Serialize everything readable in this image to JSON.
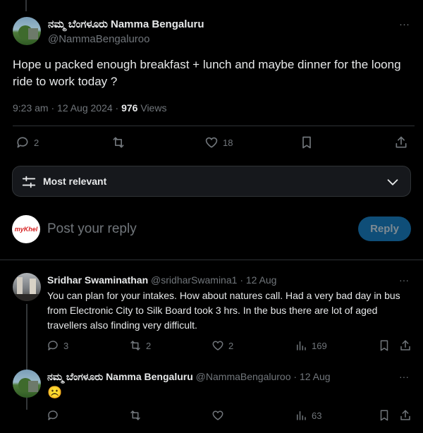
{
  "tweet": {
    "author_name": "ನಮ್ಮ ಬೆಂಗಳೂರು Namma Bengaluru",
    "handle": "@NammaBengaluroo",
    "text": "Hope u packed enough breakfast + lunch and maybe dinner for the loong ride to work today ?",
    "time": "9:23 am · 12 Aug 2024 · ",
    "views_count": "976",
    "views_label": " Views",
    "replies": "2",
    "likes": "18",
    "more": "···"
  },
  "filter": {
    "label": "Most relevant"
  },
  "compose": {
    "avatar_text": "myKhel",
    "placeholder": "Post your reply",
    "reply_button": "Reply"
  },
  "replies": [
    {
      "name": "Sridhar Swaminathan",
      "handle": "@sridharSwamina1",
      "time": "· 12 Aug",
      "text": "You can plan for your intakes.  How about natures call.  Had a very bad day in bus from Electronic City to Silk Board took 3 hrs. In the bus there are lot of aged travellers also finding very difficult.",
      "comments": "3",
      "retweets": "2",
      "likes": "2",
      "views": "169",
      "more": "···"
    },
    {
      "name": "ನಮ್ಮ ಬೆಂಗಳೂರು Namma Bengaluru",
      "handle": "@NammaBengaluroo",
      "time": "· 12 Aug",
      "text": "☹️",
      "comments": "",
      "retweets": "",
      "likes": "",
      "views": "63",
      "more": "···"
    }
  ],
  "colors": {
    "accent": "#1d9bf0",
    "reply_button_bg": "#0f4e78",
    "border": "#2f3336",
    "muted": "#71767b"
  }
}
